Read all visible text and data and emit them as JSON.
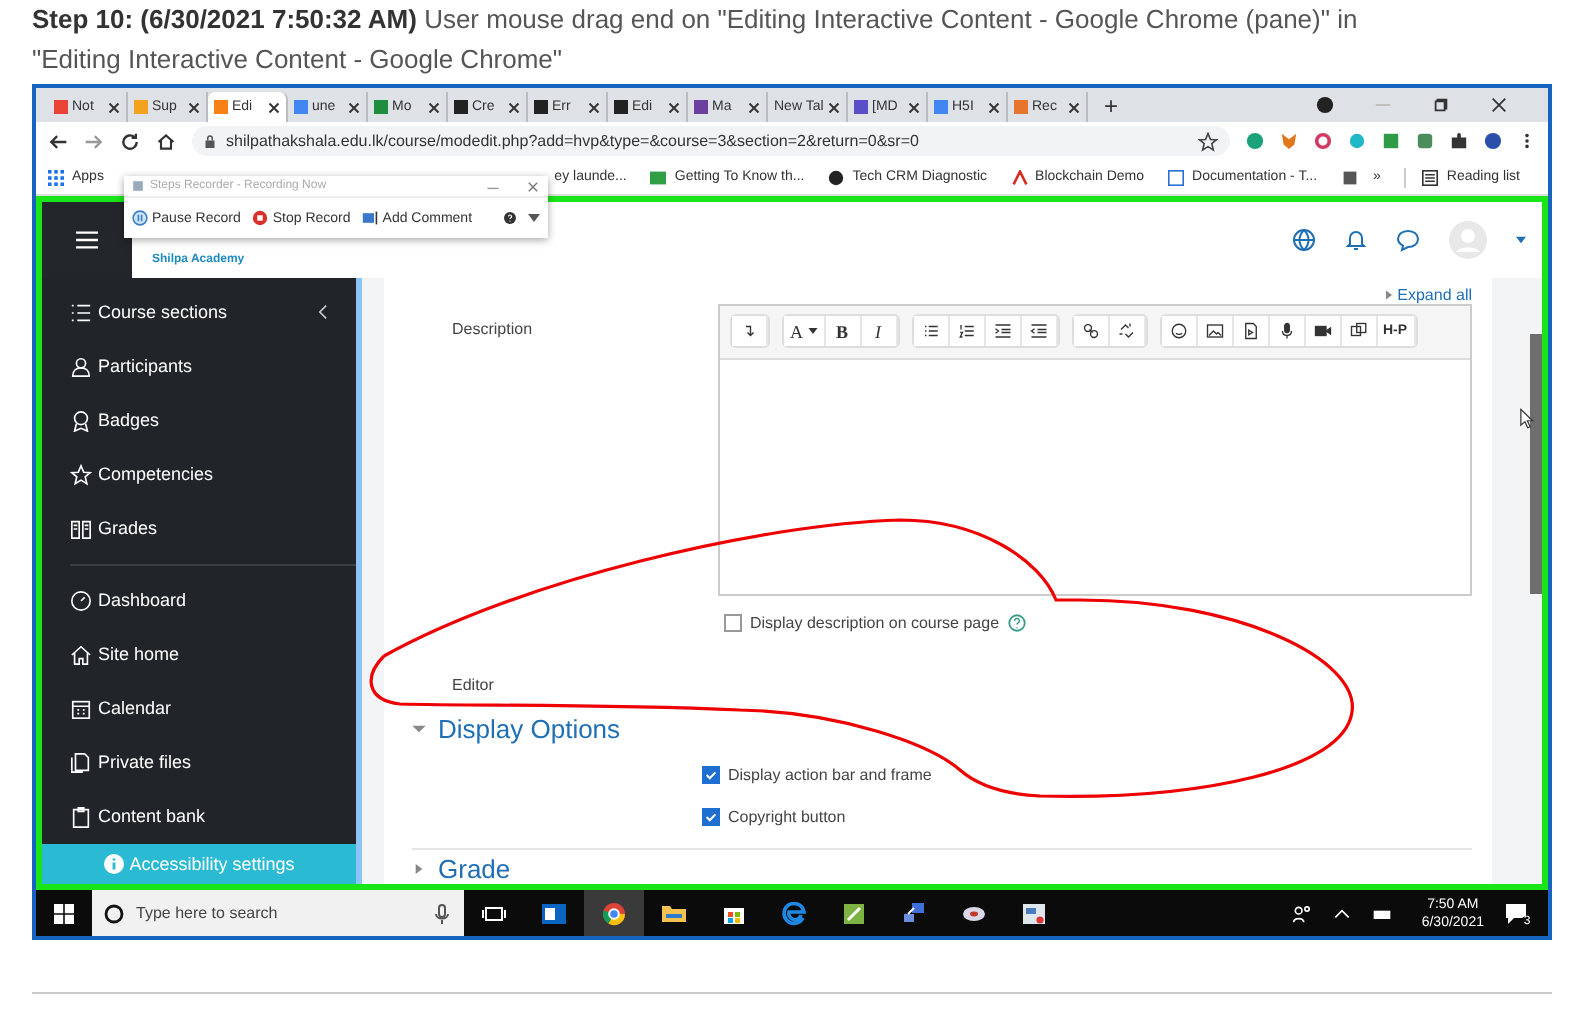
{
  "caption": {
    "step": "Step 10: (6/30/2021 7:50:32 AM)",
    "text": "User mouse drag end on \"Editing Interactive Content - Google Chrome (pane)\" in \"Editing Interactive Content - Google Chrome\""
  },
  "browser": {
    "tabs": [
      {
        "label": "Not",
        "selected": false,
        "color": "#ea4335"
      },
      {
        "label": "Sup",
        "selected": false,
        "color": "#f4a21d"
      },
      {
        "label": "Edi",
        "selected": true,
        "color": "#f98012"
      },
      {
        "label": "une",
        "selected": false,
        "color": "#4285f4"
      },
      {
        "label": "Mo",
        "selected": false,
        "color": "#1e8e3e"
      },
      {
        "label": "Cre",
        "selected": false,
        "color": "#222222"
      },
      {
        "label": "Err",
        "selected": false,
        "color": "#222222"
      },
      {
        "label": "Edi",
        "selected": false,
        "color": "#222222"
      },
      {
        "label": "Ma",
        "selected": false,
        "color": "#6a3fa0"
      },
      {
        "label": "New Tal",
        "selected": false
      },
      {
        "label": "[MD",
        "selected": false,
        "color": "#5b4fc9"
      },
      {
        "label": "H5I",
        "selected": false,
        "color": "#4285f4"
      },
      {
        "label": "Rec",
        "selected": false,
        "color": "#e9742b"
      }
    ],
    "new_tab": "+",
    "url": "shilpathakshala.edu.lk/course/modedit.php?add=hvp&type=&course=3&section=2&return=0&sr=0",
    "bookmarks": [
      "Apps",
      "ey launde...",
      "Getting To Know th...",
      "Tech CRM Diagnostic",
      "Blockchain Demo",
      "Documentation - T..."
    ],
    "more": "»",
    "reading_list": "Reading list"
  },
  "recorder": {
    "title": "Steps Recorder - Recording Now",
    "buttons": [
      "Pause Record",
      "Stop Record",
      "Add Comment"
    ]
  },
  "site": {
    "logo": "Shilpa Academy",
    "nav_groups": [
      [
        "Course sections",
        "Participants",
        "Badges",
        "Competencies",
        "Grades"
      ],
      [
        "Dashboard",
        "Site home",
        "Calendar",
        "Private files",
        "Content bank"
      ]
    ],
    "accessibility": "Accessibility settings"
  },
  "form": {
    "expand_all": "Expand all",
    "description_label": "Description",
    "toolbar": [
      [
        {
          "kind": "collapse"
        }
      ],
      [
        {
          "kind": "text",
          "label": "A"
        },
        {
          "kind": "text",
          "label": "B"
        },
        {
          "kind": "text",
          "label": "I"
        }
      ],
      [
        {
          "kind": "list"
        },
        {
          "kind": "numlist"
        },
        {
          "kind": "indent"
        },
        {
          "kind": "outdent"
        }
      ],
      [
        {
          "kind": "link"
        },
        {
          "kind": "unlink"
        }
      ],
      [
        {
          "kind": "emoji"
        },
        {
          "kind": "image"
        },
        {
          "kind": "media"
        },
        {
          "kind": "mic"
        },
        {
          "kind": "video"
        },
        {
          "kind": "copy"
        },
        {
          "kind": "text",
          "label": "H-P"
        }
      ]
    ],
    "show_description": {
      "label": "Display description on course page",
      "checked": false
    },
    "editor_label": "Editor",
    "section": {
      "title": "Display Options",
      "expanded": true,
      "options": [
        {
          "label": "Display action bar and frame",
          "checked": true
        },
        {
          "label": "Copyright button",
          "checked": true
        }
      ]
    },
    "next_section": "Grade"
  },
  "taskbar": {
    "search_placeholder": "Type here to search",
    "time": "7:50 AM",
    "date": "6/30/2021",
    "notifications": "3"
  }
}
